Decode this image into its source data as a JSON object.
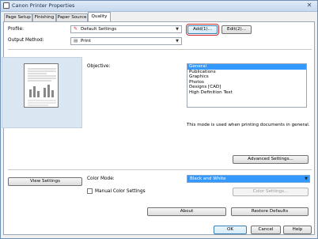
{
  "window": {
    "title": "Canon Printer Properties",
    "close": "✕"
  },
  "tabs": [
    "Page Setup",
    "Finishing",
    "Paper Source",
    "Quality"
  ],
  "profile": {
    "label": "Profile:",
    "value": "Default Settings",
    "add": "Add(1)...",
    "edit": "Edit(2)..."
  },
  "output": {
    "label": "Output Method:",
    "value": "Print"
  },
  "objective": {
    "label": "Objective:",
    "items": [
      "General",
      "Publications",
      "Graphics",
      "Photos",
      "Designs [CAD]",
      "High Definition Text"
    ],
    "description": "This mode is used when printing documents in general."
  },
  "advanced_button": "Advanced Settings...",
  "view_settings_button": "View Settings",
  "color_mode": {
    "label": "Color Mode:",
    "value": "Black and White"
  },
  "manual_color": {
    "label": "Manual Color Settings"
  },
  "color_settings_button": "Color Settings...",
  "about_button": "About",
  "restore_button": "Restore Defaults",
  "footer": {
    "ok": "OK",
    "cancel": "Cancel",
    "help": "Help"
  }
}
